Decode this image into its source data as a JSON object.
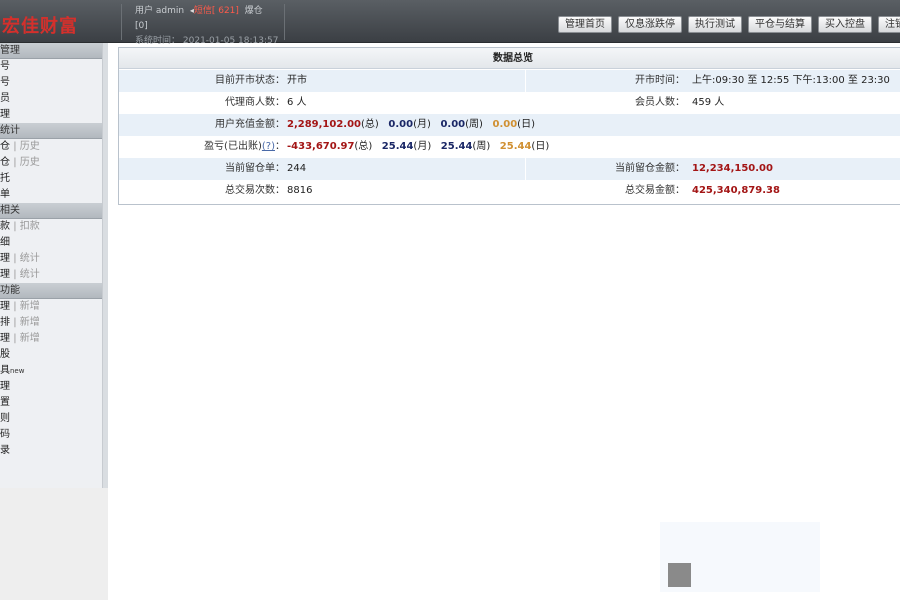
{
  "header": {
    "logo": "宏佳财富",
    "user_label": "用户",
    "user_name": "admin",
    "sms_label": "短信",
    "sms_count": "[ 621]",
    "extra": "爆仓",
    "bracket_line": "[0]",
    "time_label": "系统时间：",
    "time_value": "2021-01-05 18:13:57"
  },
  "nav": [
    "管理首页",
    "仅息涨跌停",
    "执行测试",
    "平仓与结算",
    "买入控盘",
    "注销"
  ],
  "sidebar": {
    "sections": [
      {
        "title": "管理",
        "items": [
          {
            "label": "号"
          },
          {
            "label": "号"
          },
          {
            "label": "员"
          },
          {
            "label": "理"
          }
        ]
      },
      {
        "title": "统计",
        "items": [
          {
            "label": "仓",
            "sub": "历史"
          },
          {
            "label": "仓",
            "sub": "历史"
          },
          {
            "label": "托"
          },
          {
            "label": "单"
          }
        ]
      },
      {
        "title": "相关",
        "items": [
          {
            "label": "款",
            "sub": "扣款"
          },
          {
            "label": "细"
          },
          {
            "label": "理",
            "sub": "统计"
          },
          {
            "label": "理",
            "sub": "统计"
          }
        ]
      },
      {
        "title": "功能",
        "items": [
          {
            "label": "理",
            "sub": "新增"
          },
          {
            "label": "排",
            "sub": "新增"
          },
          {
            "label": "理",
            "sub": "新增"
          },
          {
            "label": "股"
          },
          {
            "label": "具",
            "badge": "new"
          },
          {
            "label": "理"
          },
          {
            "label": "置"
          },
          {
            "label": "则"
          },
          {
            "label": "码"
          },
          {
            "label": "录"
          }
        ]
      }
    ]
  },
  "panel": {
    "title": "数据总览",
    "rows": {
      "status_label": "目前开市状态：",
      "status_value": "开市",
      "hours_label": "开市时间：",
      "hours_value": "上午:09:30 至 12:55  下午:13:00 至 23:30",
      "agents_label": "代理商人数：",
      "agents_value": "6 人",
      "members_label": "会员人数：",
      "members_value": "459 人",
      "recharge_label": "用户充值金额：",
      "recharge_total": "2,289,102.00",
      "recharge_total_unit": "(总)",
      "recharge_month": "0.00",
      "recharge_month_unit": "(月)",
      "recharge_week": "0.00",
      "recharge_week_unit": "(周)",
      "recharge_day": "0.00",
      "recharge_day_unit": "(日)",
      "pnl_label": "盈亏(已出账)",
      "pnl_help": "(?)",
      "pnl_colon": "：",
      "pnl_total": "-433,670.97",
      "pnl_total_unit": "(总)",
      "pnl_month": "25.44",
      "pnl_month_unit": "(月)",
      "pnl_week": "25.44",
      "pnl_week_unit": "(周)",
      "pnl_day": "25.44",
      "pnl_day_unit": "(日)",
      "positions_label": "当前留仓单：",
      "positions_value": "244",
      "pos_amount_label": "当前留仓金额：",
      "pos_amount_value": "12,234,150.00",
      "trades_label": "总交易次数：",
      "trades_value": "8816",
      "trade_amount_label": "总交易金额：",
      "trade_amount_value": "425,340,879.38"
    }
  }
}
